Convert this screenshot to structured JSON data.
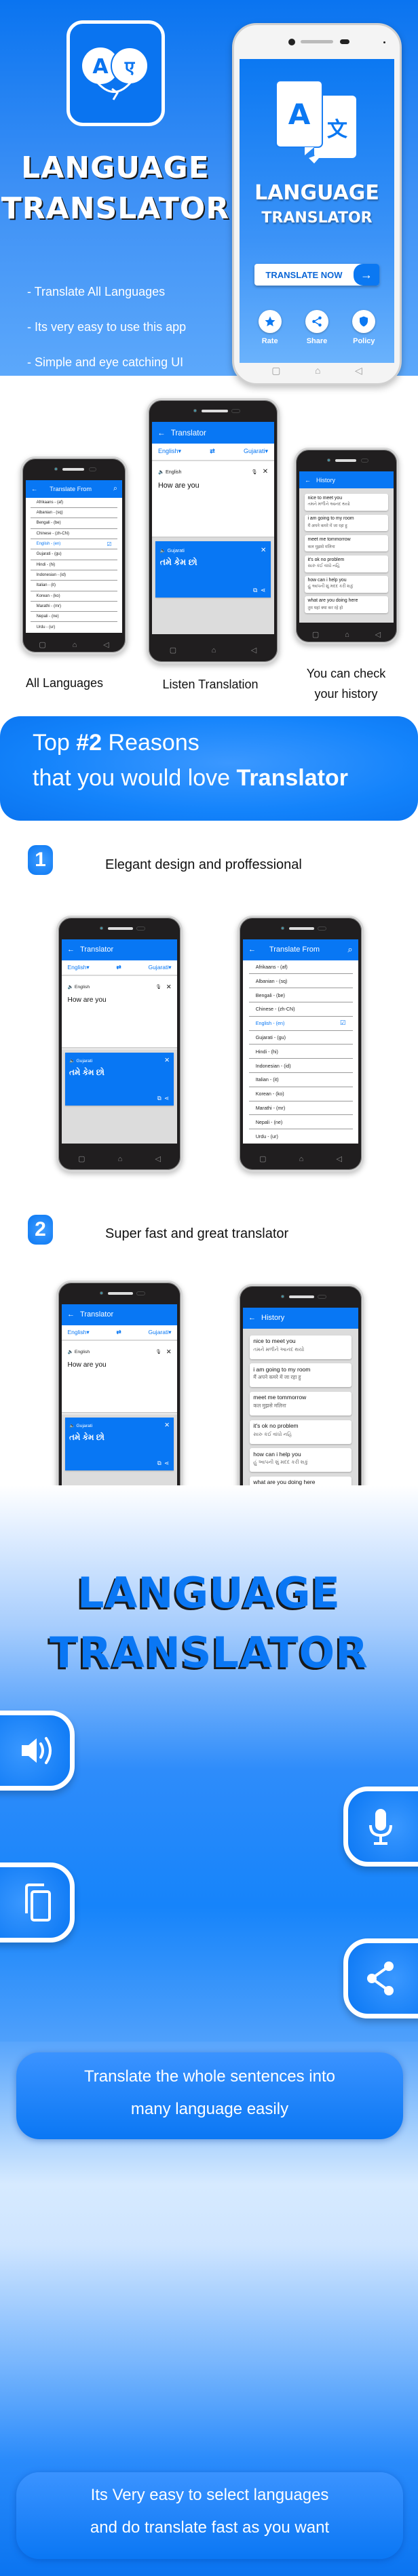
{
  "hero": {
    "app_icon": {
      "left_glyph": "A",
      "right_glyph": "ए"
    },
    "title_line1": "LANGUAGE",
    "title_line2": "TRANSLATOR",
    "bullets": [
      "- Translate All Languages",
      "- Its very easy to use this app",
      "- Simple and eye catching UI"
    ],
    "phone": {
      "logo_glyph_a": "A",
      "logo_glyph_b": "文",
      "title_line1": "LANGUAGE",
      "title_line2": "TRANSLATOR",
      "cta_label": "TRANSLATE NOW",
      "cta_arrow": "→",
      "actions": [
        {
          "label": "Rate",
          "icon": "star-icon"
        },
        {
          "label": "Share",
          "icon": "share-icon"
        },
        {
          "label": "Policy",
          "icon": "shield-icon"
        }
      ],
      "nav": [
        "▢",
        "⌂",
        "◁"
      ]
    }
  },
  "translator_screen": {
    "title": "Translator",
    "back": "←",
    "from_lang": "English▾",
    "to_lang": "Gujarati▾",
    "swap": "⇄",
    "input_label": "🔈 English",
    "input_text": "How are you",
    "mic": "🎙",
    "clear": "✕",
    "output_label": "🔈 Gujarati",
    "output_text": "તમે કેમ છો",
    "output_clear": "✕",
    "copy": "⧉",
    "share": "⋖"
  },
  "languages_screen": {
    "title": "Translate From",
    "back": "←",
    "search": "⌕",
    "selected_mark": "☑",
    "items": [
      {
        "label": "Afrikaans - (af)",
        "selected": false
      },
      {
        "label": "Albanian - (sq)",
        "selected": false
      },
      {
        "label": "Bengali - (be)",
        "selected": false
      },
      {
        "label": "Chinese - (zh-CN)",
        "selected": false
      },
      {
        "label": "English - (en)",
        "selected": true
      },
      {
        "label": "Gujarati - (gu)",
        "selected": false
      },
      {
        "label": "Hindi - (hi)",
        "selected": false
      },
      {
        "label": "Indonesian - (id)",
        "selected": false
      },
      {
        "label": "Italian - (it)",
        "selected": false
      },
      {
        "label": "Korean - (ko)",
        "selected": false
      },
      {
        "label": "Marathi - (mr)",
        "selected": false
      },
      {
        "label": "Nepali - (ne)",
        "selected": false
      },
      {
        "label": "Urdu - (ur)",
        "selected": false
      }
    ]
  },
  "history_screen": {
    "title": "History",
    "back": "←",
    "items": [
      {
        "source": "nice to meet you",
        "translation": "તમને મળીને આનંદ થયો"
      },
      {
        "source": "i am going to my room",
        "translation": "मैं अपने कमरे में जा रहा हु"
      },
      {
        "source": "meet me tommorrow",
        "translation": "कल मुझसे मलिना"
      },
      {
        "source": "it's ok no problem",
        "translation": "સારુ કંઈ વાંધો નહિ"
      },
      {
        "source": "how can i help you",
        "translation": "હું આપની શું મદદ કરી શકું"
      },
      {
        "source": "what are you doing here",
        "translation": "तुम यहां क्या कर रहे हो"
      }
    ]
  },
  "phone_nav": [
    "▢",
    "⌂",
    "◁"
  ],
  "showcase_captions": {
    "languages": "All Languages",
    "listen": "Listen Translation",
    "history_line1": "You can check",
    "history_line2": "your history"
  },
  "banner": {
    "line1_prefix": "Top ",
    "line1_bold": "#2",
    "line1_suffix": " Reasons",
    "line2_prefix": "that you would love ",
    "line2_bold": "Translator"
  },
  "reasons": [
    {
      "number": "1",
      "text": "Elegant design and proffessional"
    },
    {
      "number": "2",
      "text": "Super fast and great translator"
    }
  ],
  "big_title": {
    "line1": "LANGUAGE",
    "line2": "TRANSLATOR"
  },
  "feature_icons": [
    "speaker-icon",
    "microphone-icon",
    "copy-icon",
    "share-icon"
  ],
  "pill_1": {
    "line1": "Translate the whole sentences into",
    "line2": "many language easily"
  },
  "pill_2": {
    "line1": "Its Very easy to select languages",
    "line2": "and do translate fast as you want"
  },
  "colors": {
    "brand_blue": "#0877f4",
    "screen_gray": "#dcdcdc",
    "phone_body": "#201e1f"
  }
}
